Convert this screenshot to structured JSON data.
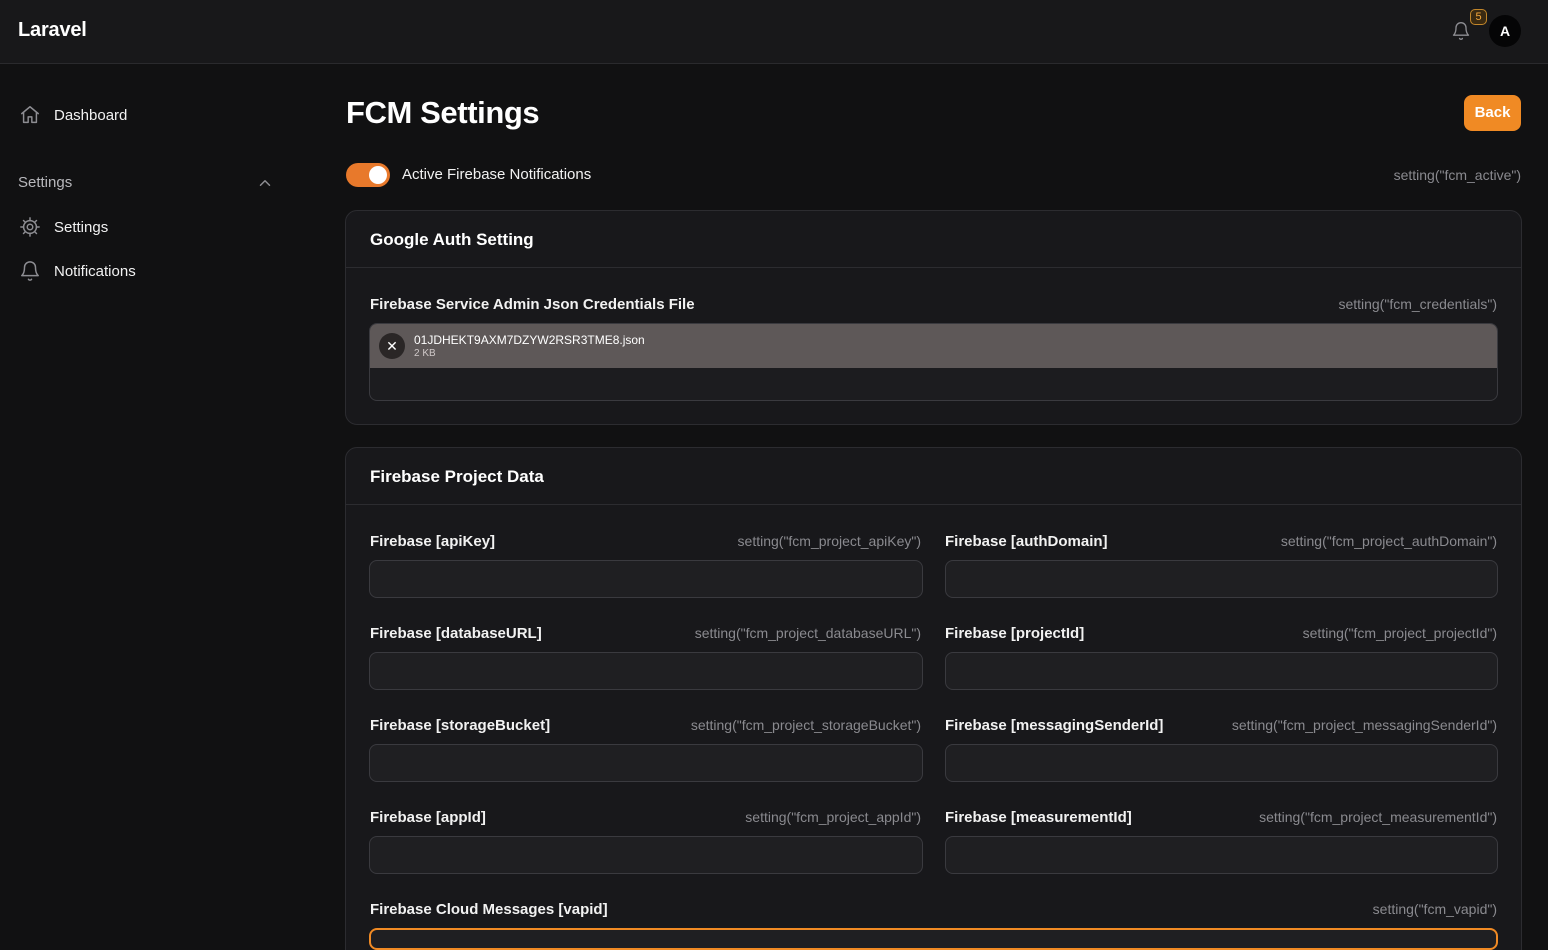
{
  "app": {
    "brand": "Laravel"
  },
  "header": {
    "notification_count": "5",
    "avatar_initial": "A"
  },
  "sidebar": {
    "items": [
      {
        "label": "Dashboard",
        "icon": "home-icon"
      }
    ],
    "group": {
      "label": "Settings",
      "expanded": true,
      "items": [
        {
          "label": "Settings",
          "icon": "gear-icon"
        },
        {
          "label": "Notifications",
          "icon": "bell-icon"
        }
      ]
    }
  },
  "page": {
    "title": "FCM Settings",
    "back_label": "Back",
    "accent_color": "#f08a24"
  },
  "active_toggle": {
    "label": "Active Firebase Notifications",
    "hint": "setting(\"fcm_active\")",
    "on": true
  },
  "google_auth": {
    "title": "Google Auth Setting",
    "credentials": {
      "label": "Firebase Service Admin Json Credentials File",
      "hint": "setting(\"fcm_credentials\")",
      "file_name": "01JDHEKT9AXM7DZYW2RSR3TME8.json",
      "file_size": "2 KB"
    }
  },
  "project": {
    "title": "Firebase Project Data",
    "fields": [
      {
        "label": "Firebase [apiKey]",
        "hint": "setting(\"fcm_project_apiKey\")",
        "value": ""
      },
      {
        "label": "Firebase [authDomain]",
        "hint": "setting(\"fcm_project_authDomain\")",
        "value": ""
      },
      {
        "label": "Firebase [databaseURL]",
        "hint": "setting(\"fcm_project_databaseURL\")",
        "value": ""
      },
      {
        "label": "Firebase [projectId]",
        "hint": "setting(\"fcm_project_projectId\")",
        "value": ""
      },
      {
        "label": "Firebase [storageBucket]",
        "hint": "setting(\"fcm_project_storageBucket\")",
        "value": ""
      },
      {
        "label": "Firebase [messagingSenderId]",
        "hint": "setting(\"fcm_project_messagingSenderId\")",
        "value": ""
      },
      {
        "label": "Firebase [appId]",
        "hint": "setting(\"fcm_project_appId\")",
        "value": ""
      },
      {
        "label": "Firebase [measurementId]",
        "hint": "setting(\"fcm_project_measurementId\")",
        "value": ""
      }
    ],
    "vapid": {
      "label": "Firebase Cloud Messages [vapid]",
      "hint": "setting(\"fcm_vapid\")",
      "value": ""
    }
  }
}
